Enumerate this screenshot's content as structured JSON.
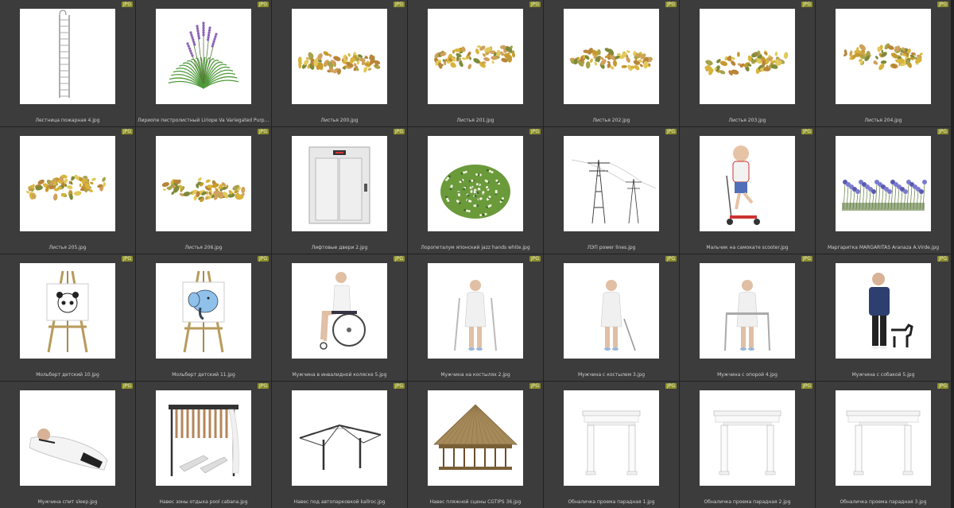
{
  "badge_text": "JPG",
  "items": [
    {
      "label": "Лестница пожарная 4.jpg",
      "icon": "ladder-icon"
    },
    {
      "label": "Лириопе пестролистный Liriope Va Variegated Purple.jpg",
      "icon": "liriope-plant-icon"
    },
    {
      "label": "Листья 200.jpg",
      "icon": "leaves-icon"
    },
    {
      "label": "Листья 201.jpg",
      "icon": "leaves-icon"
    },
    {
      "label": "Листья 202.jpg",
      "icon": "leaves-icon"
    },
    {
      "label": "Листья 203.jpg",
      "icon": "leaves-icon"
    },
    {
      "label": "Листья 204.jpg",
      "icon": "leaves-icon"
    },
    {
      "label": "Листья 205.jpg",
      "icon": "leaves-icon"
    },
    {
      "label": "Листья 206.jpg",
      "icon": "leaves-icon"
    },
    {
      "label": "Лифтовые двери 2.jpg",
      "icon": "elevator-doors-icon"
    },
    {
      "label": "Лоропеталум японский jazz hands white.jpg",
      "icon": "shrub-icon"
    },
    {
      "label": "ЛЭП power lines.jpg",
      "icon": "power-lines-icon"
    },
    {
      "label": "Мальчик на самокате scooter.jpg",
      "icon": "boy-scooter-icon"
    },
    {
      "label": "Маргаритка MARGARITAS Aranaza A.Virde.jpg",
      "icon": "daisies-icon"
    },
    {
      "label": "Мольберт детский 10.jpg",
      "icon": "easel-panda-icon"
    },
    {
      "label": "Мольберт детский 11.jpg",
      "icon": "easel-elephant-icon"
    },
    {
      "label": "Мужчина в инвалидной коляске 5.jpg",
      "icon": "man-wheelchair-icon"
    },
    {
      "label": "Мужчина на костылях 2.jpg",
      "icon": "man-crutches-icon"
    },
    {
      "label": "Мужчина с костылем 3.jpg",
      "icon": "man-cane-icon"
    },
    {
      "label": "Мужчина с опорой 4.jpg",
      "icon": "man-walker-icon"
    },
    {
      "label": "Мужчина с собакой 5.jpg",
      "icon": "man-dog-icon"
    },
    {
      "label": "Мужчина спит sleep.jpg",
      "icon": "man-sleeping-icon"
    },
    {
      "label": "Навес зоны отдыха pool cabana.jpg",
      "icon": "cabana-icon"
    },
    {
      "label": "Навес под автопарковкой kallroc.jpg",
      "icon": "parking-canopy-icon"
    },
    {
      "label": "Навес пляжной сцены CGTIPS 36.jpg",
      "icon": "beach-hut-icon"
    },
    {
      "label": "Обналичка проема парадная 1.jpg",
      "icon": "door-frame-icon"
    },
    {
      "label": "Обналичка проема парадная 2.jpg",
      "icon": "door-frame-icon"
    },
    {
      "label": "Обналичка проема парадная 3.jpg",
      "icon": "door-frame-icon"
    }
  ]
}
